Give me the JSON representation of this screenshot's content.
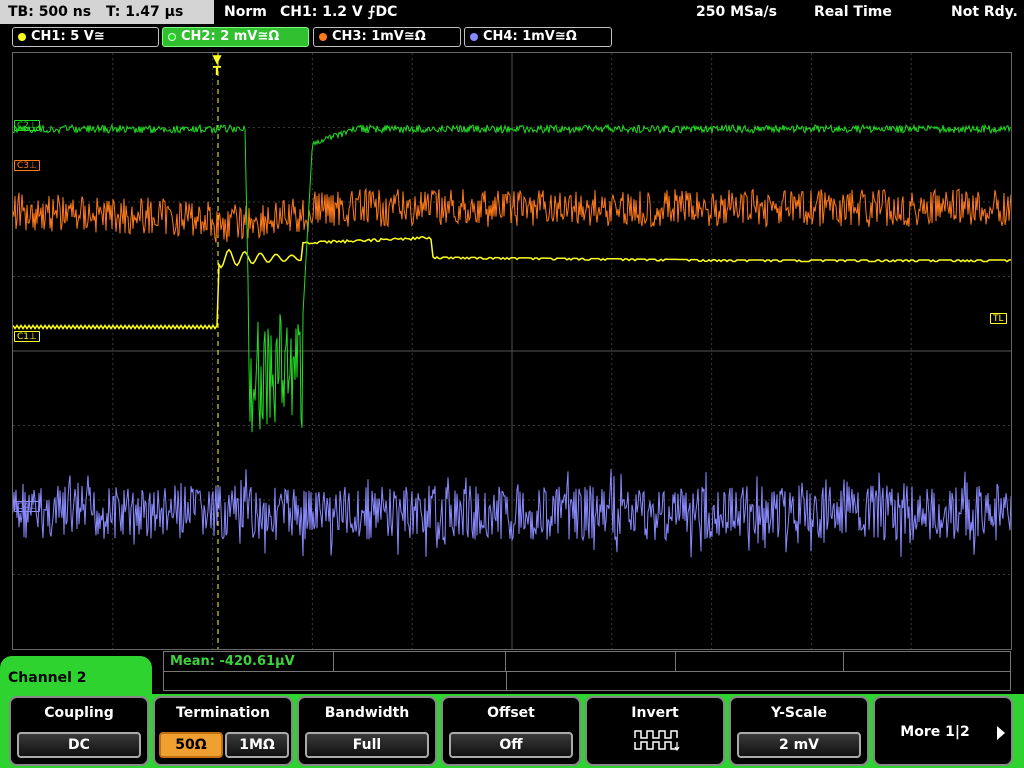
{
  "topbar": {
    "timebase": "TB: 500 ns",
    "trigger_time": "T: 1.47 µs",
    "mode": "Norm",
    "trigger": "CH1: 1.2 V ⨍DC",
    "sample_rate": "250 MSa/s",
    "acq_mode": "Real Time",
    "status": "Not Rdy."
  },
  "channels": [
    {
      "label": "CH1: 5 V≅",
      "color": "#ffff20",
      "active": false
    },
    {
      "label": "CH2: 2 mV≅Ω",
      "color": "#22dd22",
      "active": true
    },
    {
      "label": "CH3: 1mV≅Ω",
      "color": "#ff7a1a",
      "active": false
    },
    {
      "label": "CH4: 1mV≅Ω",
      "color": "#8a8aff",
      "active": false
    }
  ],
  "markers": {
    "c2": "C2⊥",
    "c3": "C3⊥",
    "c1": "C1⊥",
    "tl": "TL",
    "c4": "C4⊥",
    "trigger": "T"
  },
  "measure": {
    "mean": "Mean: -420.61µV"
  },
  "menu": {
    "channel": "Channel 2"
  },
  "softkeys": {
    "coupling": {
      "title": "Coupling",
      "value": "DC"
    },
    "termination": {
      "title": "Termination",
      "opt1": "50Ω",
      "opt2": "1MΩ"
    },
    "bandwidth": {
      "title": "Bandwidth",
      "value": "Full"
    },
    "offset": {
      "title": "Offset",
      "value": "Off"
    },
    "invert": {
      "title": "Invert",
      "icon": "invert-square-wave-icon"
    },
    "yscale": {
      "title": "Y-Scale",
      "value": "2 mV"
    },
    "more": {
      "label": "More 1|2"
    }
  }
}
